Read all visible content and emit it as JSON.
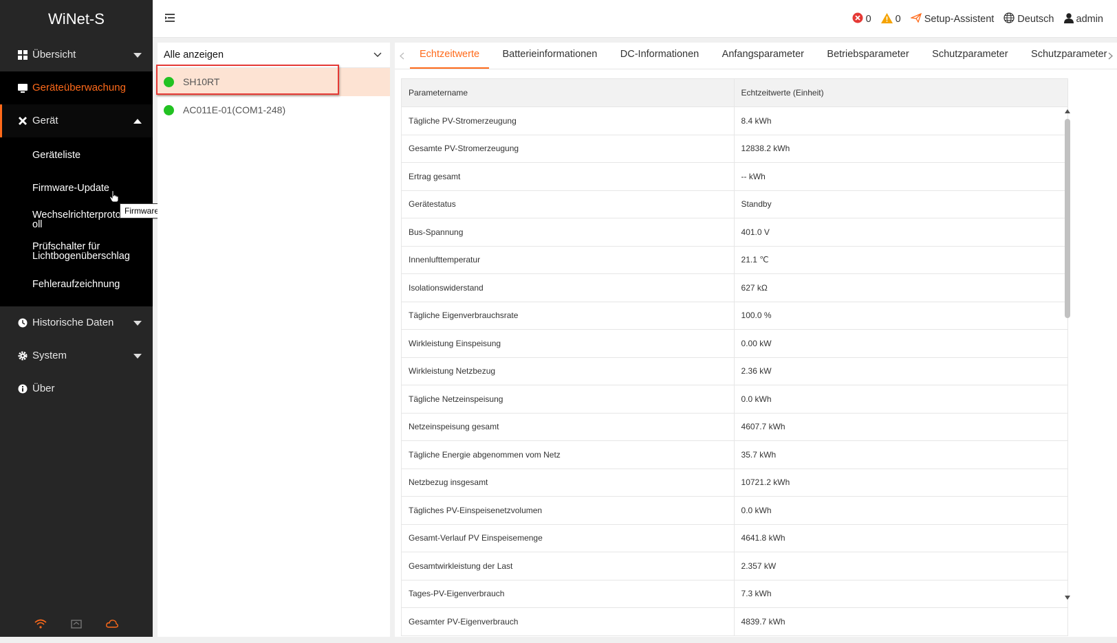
{
  "app": {
    "brand": "WiNet-S"
  },
  "sidebar": {
    "nav": [
      {
        "label": "Übersicht"
      },
      {
        "label": "Geräteüberwachung"
      },
      {
        "label": "Gerät"
      }
    ],
    "submenu": [
      {
        "label": "Geräteliste"
      },
      {
        "label": "Firmware-Update"
      },
      {
        "label": "Wechselrichterprotokoll"
      },
      {
        "label": "Prüfschalter für Lichtbogenüberschlag"
      },
      {
        "label": "Fehleraufzeichnung"
      }
    ],
    "nav_bottom": [
      {
        "label": "Historische Daten"
      },
      {
        "label": "System"
      },
      {
        "label": "Über"
      }
    ]
  },
  "tooltip": {
    "text": "Firmware-Update"
  },
  "header": {
    "error_count": "0",
    "warning_count": "0",
    "setup_label": "Setup-Assistent",
    "language": "Deutsch",
    "user": "admin"
  },
  "devices": {
    "filter_label": "Alle anzeigen",
    "items": [
      {
        "name": "SH10RT",
        "status_color": "#22c222"
      },
      {
        "name": "AC011E-01(COM1-248)",
        "status_color": "#22c222"
      }
    ]
  },
  "tabs": [
    {
      "label": "Echtzeitwerte"
    },
    {
      "label": "Batterieinformationen"
    },
    {
      "label": "DC-Informationen"
    },
    {
      "label": "Anfangsparameter"
    },
    {
      "label": "Betriebsparameter"
    },
    {
      "label": "Schutzparameter"
    },
    {
      "label": "Schutzparameter (S"
    }
  ],
  "table": {
    "headers": [
      "Parametername",
      "Echtzeitwerte (Einheit)"
    ],
    "rows": [
      [
        "Tägliche PV-Stromerzeugung",
        "8.4 kWh"
      ],
      [
        "Gesamte PV-Stromerzeugung",
        "12838.2 kWh"
      ],
      [
        "Ertrag gesamt",
        "-- kWh"
      ],
      [
        "Gerätestatus",
        "Standby"
      ],
      [
        "Bus-Spannung",
        "401.0 V"
      ],
      [
        "Innenlufttemperatur",
        "21.1 ℃"
      ],
      [
        "Isolationswiderstand",
        "627 kΩ"
      ],
      [
        "Tägliche Eigenverbrauchsrate",
        "100.0 %"
      ],
      [
        "Wirkleistung Einspeisung",
        "0.00 kW"
      ],
      [
        "Wirkleistung Netzbezug",
        "2.36 kW"
      ],
      [
        "Tägliche Netzeinspeisung",
        "0.0 kWh"
      ],
      [
        "Netzeinspeisung gesamt",
        "4607.7 kWh"
      ],
      [
        "Tägliche Energie abgenommen vom Netz",
        "35.7 kWh"
      ],
      [
        "Netzbezug insgesamt",
        "10721.2 kWh"
      ],
      [
        "Tägliches PV-Einspeisenetzvolumen",
        "0.0 kWh"
      ],
      [
        "Gesamt-Verlauf PV Einspeisemenge",
        "4641.8 kWh"
      ],
      [
        "Gesamtwirkleistung der Last",
        "2.357 kW"
      ],
      [
        "Tages-PV-Eigenverbrauch",
        "7.3 kWh"
      ],
      [
        "Gesamter PV-Eigenverbrauch",
        "4839.7 kWh"
      ]
    ]
  },
  "colors": {
    "accent": "#ff6a1a",
    "sidebar_bg": "#262626",
    "selected_row": "#fde3d3",
    "highlight": "#e53935",
    "status_green": "#22c222"
  },
  "icons": [
    "grid-icon",
    "monitor-icon",
    "wrench-icon",
    "clock-icon",
    "gear-icon",
    "info-icon",
    "wifi-icon",
    "home-icon",
    "cloud-icon",
    "menu-collapse-icon",
    "error-icon",
    "warning-icon",
    "send-icon",
    "globe-icon",
    "user-icon"
  ]
}
